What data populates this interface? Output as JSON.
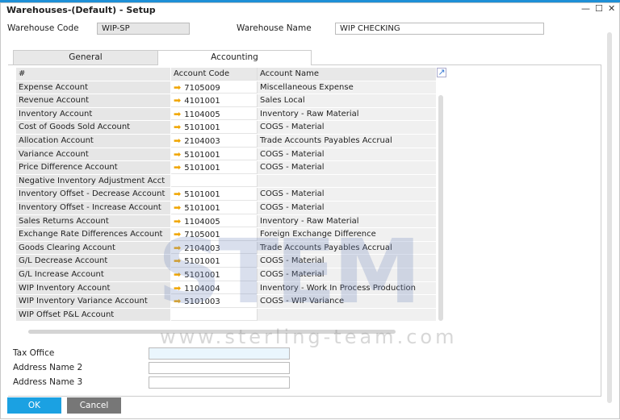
{
  "window": {
    "title": "Warehouses-(Default) - Setup",
    "min": "—",
    "max": "☐",
    "close": "✕"
  },
  "header": {
    "code_label": "Warehouse Code",
    "code_value": "WIP-SP",
    "name_label": "Warehouse Name",
    "name_value": "WIP CHECKING"
  },
  "tabs": [
    {
      "label": "General"
    },
    {
      "label": "Accounting"
    }
  ],
  "grid": {
    "columns": [
      "#",
      "Account Code",
      "Account Name"
    ],
    "rows": [
      [
        "Expense Account",
        "7105009",
        "Miscellaneous Expense"
      ],
      [
        "Revenue Account",
        "4101001",
        "Sales Local"
      ],
      [
        "Inventory Account",
        "1104005",
        "Inventory - Raw Material"
      ],
      [
        "Cost of Goods Sold Account",
        "5101001",
        "COGS - Material"
      ],
      [
        "Allocation Account",
        "2104003",
        "Trade Accounts Payables Accrual"
      ],
      [
        "Variance Account",
        "5101001",
        "COGS - Material"
      ],
      [
        "Price Difference Account",
        "5101001",
        "COGS - Material"
      ],
      [
        "Negative Inventory Adjustment Acct",
        "",
        ""
      ],
      [
        "Inventory Offset - Decrease Account",
        "5101001",
        "COGS - Material"
      ],
      [
        "Inventory Offset - Increase Account",
        "5101001",
        "COGS - Material"
      ],
      [
        "Sales Returns Account",
        "1104005",
        "Inventory - Raw Material"
      ],
      [
        "Exchange Rate Differences Account",
        "7105001",
        "Foreign Exchange Difference"
      ],
      [
        "Goods Clearing Account",
        "2104003",
        "Trade Accounts Payables Accrual"
      ],
      [
        "G/L Decrease Account",
        "5101001",
        "COGS - Material"
      ],
      [
        "G/L Increase Account",
        "5101001",
        "COGS - Material"
      ],
      [
        "WIP Inventory Account",
        "1104004",
        "Inventory - Work In Process Production"
      ],
      [
        "WIP Inventory Variance Account",
        "5101003",
        "COGS - WIP Variance"
      ],
      [
        "WIP Offset P&L Account",
        "",
        ""
      ]
    ]
  },
  "fields": [
    {
      "label": "Tax Office",
      "value": ""
    },
    {
      "label": "Address Name 2",
      "value": ""
    },
    {
      "label": "Address Name 3",
      "value": ""
    }
  ],
  "buttons": {
    "ok": "OK",
    "cancel": "Cancel"
  },
  "watermark": {
    "logo": "STEM",
    "url": "www.sterling-team.com"
  },
  "colors": {
    "accent": "#1e8fd6",
    "ok": "#1ba1e2",
    "cancel": "#777777"
  }
}
